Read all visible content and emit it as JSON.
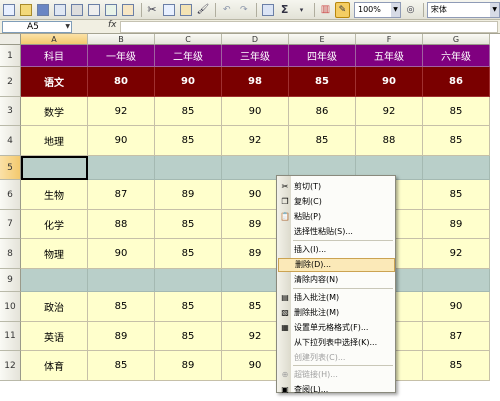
{
  "toolbar": {
    "zoom": "100%",
    "font_name": "宋体",
    "sum_symbol": "Σ"
  },
  "formula_bar": {
    "name_box": "A5",
    "fx_label": "fx",
    "value": ""
  },
  "sheet": {
    "columns": [
      "A",
      "B",
      "C",
      "D",
      "E",
      "F",
      "G"
    ],
    "rows": [
      "1",
      "2",
      "3",
      "4",
      "5",
      "6",
      "7",
      "8",
      "9",
      "10",
      "11",
      "12"
    ],
    "cells": [
      [
        "科目",
        "一年级",
        "二年级",
        "三年级",
        "四年级",
        "五年级",
        "六年级"
      ],
      [
        "语文",
        "80",
        "90",
        "98",
        "85",
        "90",
        "86"
      ],
      [
        "数学",
        "92",
        "85",
        "90",
        "86",
        "92",
        "85"
      ],
      [
        "地理",
        "90",
        "85",
        "92",
        "85",
        "88",
        "85"
      ],
      [
        "",
        "",
        "",
        "",
        "",
        "",
        ""
      ],
      [
        "生物",
        "87",
        "89",
        "90",
        "",
        "",
        "85"
      ],
      [
        "化学",
        "88",
        "85",
        "89",
        "",
        "",
        "89"
      ],
      [
        "物理",
        "90",
        "85",
        "89",
        "",
        "",
        "92"
      ],
      [
        "",
        "",
        "",
        "",
        "",
        "",
        ""
      ],
      [
        "政治",
        "85",
        "85",
        "85",
        "",
        "",
        "90"
      ],
      [
        "英语",
        "89",
        "85",
        "92",
        "",
        "",
        "87"
      ],
      [
        "体育",
        "85",
        "89",
        "90",
        "",
        "",
        "85"
      ]
    ]
  },
  "context_menu": {
    "items": [
      {
        "label": "剪切(T)",
        "icon": "scissors-icon",
        "glyph": "✂"
      },
      {
        "label": "复制(C)",
        "icon": "copy-icon",
        "glyph": "❐"
      },
      {
        "label": "粘贴(P)",
        "icon": "paste-icon",
        "glyph": "📋"
      },
      {
        "label": "选择性粘贴(S)...",
        "icon": "",
        "glyph": ""
      },
      {
        "label": "插入(I)...",
        "icon": "",
        "glyph": ""
      },
      {
        "label": "删除(D)...",
        "icon": "",
        "glyph": ""
      },
      {
        "label": "清除内容(N)",
        "icon": "",
        "glyph": ""
      },
      {
        "label": "插入批注(M)",
        "icon": "insert-comment-icon",
        "glyph": "▤"
      },
      {
        "label": "删除批注(M)",
        "icon": "delete-comment-icon",
        "glyph": "▧"
      },
      {
        "label": "设置单元格格式(F)...",
        "icon": "format-cells-icon",
        "glyph": "▦"
      },
      {
        "label": "从下拉列表中选择(K)...",
        "icon": "",
        "glyph": ""
      },
      {
        "label": "创建列表(C)...",
        "icon": "",
        "glyph": ""
      },
      {
        "label": "超链接(H)...",
        "icon": "hyperlink-icon",
        "glyph": "⊕"
      },
      {
        "label": "查阅(L)...",
        "icon": "research-icon",
        "glyph": "▣"
      }
    ]
  }
}
